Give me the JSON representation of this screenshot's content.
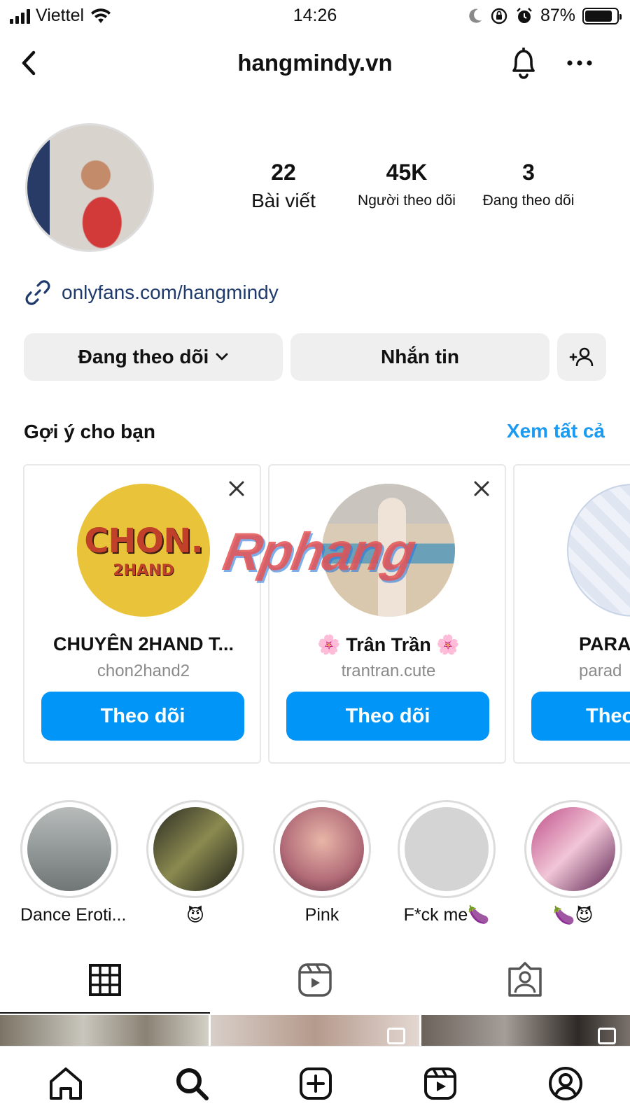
{
  "status_bar": {
    "carrier": "Viettel",
    "time": "14:26",
    "battery": "87%",
    "battery_level": 0.87
  },
  "header": {
    "username": "hangmindy.vn"
  },
  "profile": {
    "stats": [
      {
        "value": "22",
        "label": "Bài viết"
      },
      {
        "value": "45K",
        "label": "Người theo dõi"
      },
      {
        "value": "3",
        "label": "Đang theo dõi"
      }
    ],
    "link": "onlyfans.com/hangmindy"
  },
  "actions": {
    "following": "Đang theo dõi",
    "message": "Nhắn tin"
  },
  "suggestions": {
    "title": "Gợi ý cho bạn",
    "see_all": "Xem tất cả",
    "cards": [
      {
        "name": "CHUYÊN 2HAND T...",
        "handle": "chon2hand2",
        "button": "Theo dõi",
        "avatar_text": "CHON.",
        "avatar_sub": "2HAND"
      },
      {
        "name": "🌸 Trân Trần 🌸",
        "handle": "trantran.cute",
        "button": "Theo dõi"
      },
      {
        "name": "PARA",
        "handle": "parad",
        "button": "Theo"
      }
    ]
  },
  "watermark": "Rphang",
  "highlights": [
    {
      "label": "Dance Eroti..."
    },
    {
      "label": "😈"
    },
    {
      "label": "Pink"
    },
    {
      "label": "F*ck me🍆"
    },
    {
      "label": "🍆😈"
    }
  ],
  "colors": {
    "accent": "#0095f6",
    "link_blue": "#1a9af1",
    "button_gray": "#efefef"
  },
  "icons": [
    "back-icon",
    "bell-icon",
    "more-icon",
    "link-icon",
    "chevron-down-icon",
    "add-user-icon",
    "close-icon",
    "grid-icon",
    "reels-icon",
    "tagged-icon",
    "home-icon",
    "search-icon",
    "create-icon",
    "reels-nav-icon",
    "profile-nav-icon"
  ]
}
